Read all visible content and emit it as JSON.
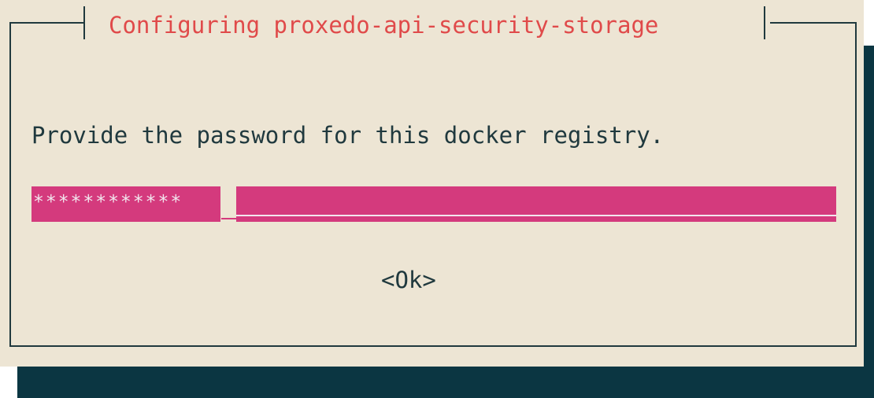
{
  "dialog": {
    "title": "Configuring proxedo-api-security-storage",
    "prompt": "Provide the password for this docker registry.",
    "password_masked": "************",
    "ok_label": "<Ok>"
  },
  "colors": {
    "background": "#ede5d4",
    "shadow": "#0b3642",
    "frame": "#20393e",
    "title": "#e04a4a",
    "text": "#20393e",
    "input_field": "#d43a7d"
  }
}
